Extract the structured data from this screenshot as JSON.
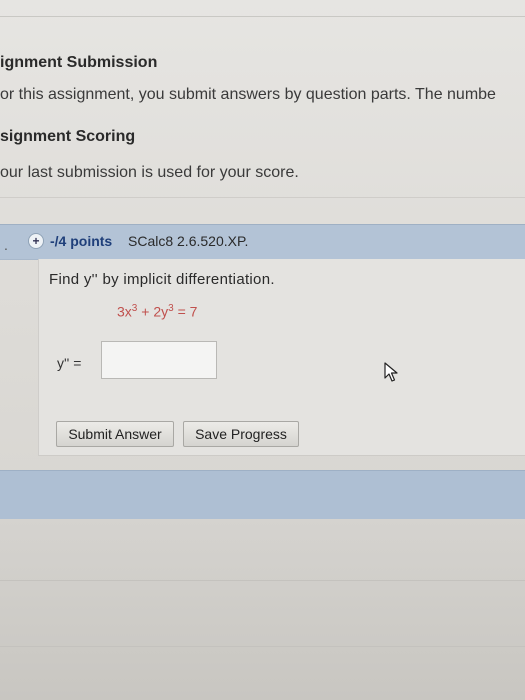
{
  "assignment_info": {
    "submission_heading": "ignment Submission",
    "submission_text": "or this assignment, you submit answers by question parts. The numbe",
    "scoring_heading": "signment Scoring",
    "scoring_text": "our last submission is used for your score."
  },
  "question": {
    "number_marker": ".",
    "expand_icon": "plus-circle-icon",
    "points": "-/4 points",
    "reference": "SCalc8 2.6.520.XP.",
    "prompt": "Find y'' by implicit differentiation.",
    "equation": {
      "term1_base": "3x",
      "term1_exp": "3",
      "plus": " + ",
      "term2_base": "2y",
      "term2_exp": "3",
      "rhs": " = 7"
    },
    "answer_label": "y'' =",
    "answer_value": ""
  },
  "buttons": {
    "submit_label": "Submit Answer",
    "save_label": "Save Progress"
  },
  "colors": {
    "header_band": "#b3c3d6",
    "points_text": "#1f3f7a",
    "equation_text": "#c0504d"
  }
}
